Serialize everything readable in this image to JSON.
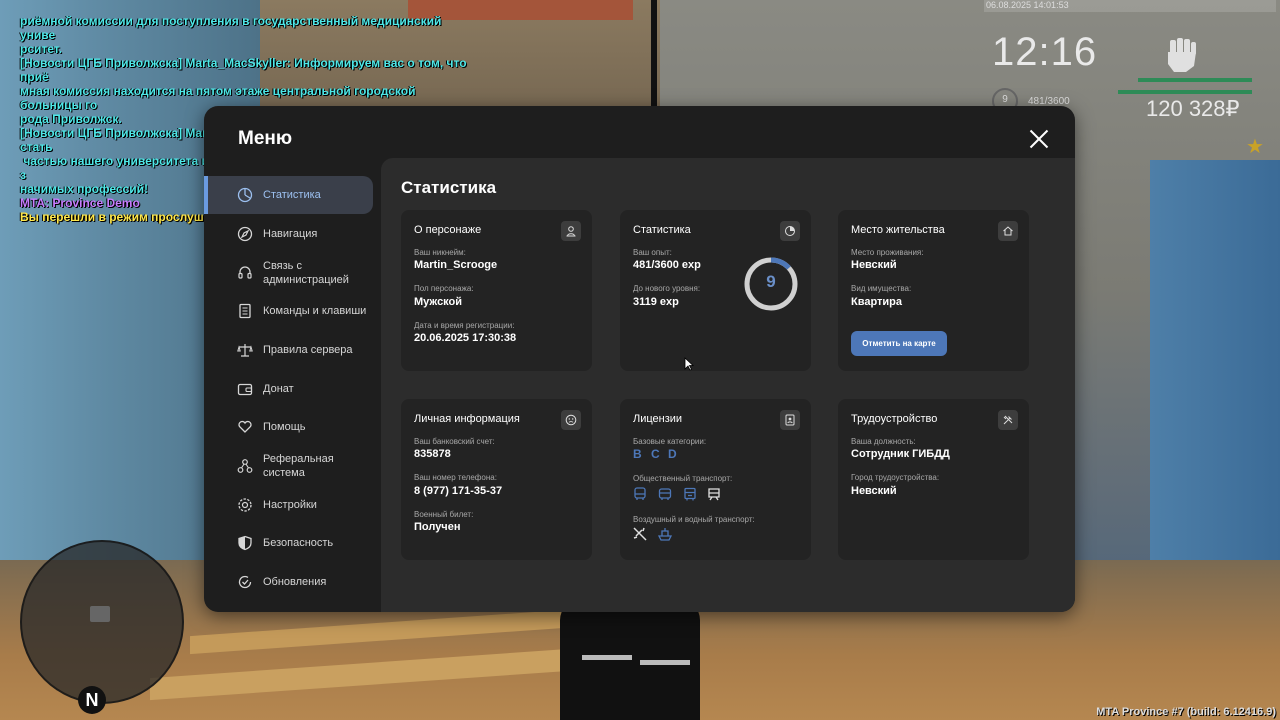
{
  "chat": [
    {
      "text": "риёмной комиссии для поступления в государственный медицинский униве\nрситет.",
      "color": "cyan"
    },
    {
      "text": "[Новости ЦГБ Приволжска] Marta_MacSkyller: Информируем вас о том, что приё\nмная комиссия находится на пятом этаже центральной городской больницы го\nрода Приволжск.",
      "color": "cyan"
    },
    {
      "text": "[Новости ЦГБ Приволжска] Marta_MacSkyller: Не упустите возможность стать\n частью нашего университета и освоить одну из самых востребованных и з\nначимых профессий!",
      "color": "cyan"
    },
    {
      "text": "MTA: Province Demo",
      "color": "purple"
    },
    {
      "text": "Вы перешли в режим прослушивания рации.",
      "color": "yellow"
    }
  ],
  "hud": {
    "datetime": "06.08.2025 14:01:53",
    "time": "12:16",
    "level": "9",
    "xp": "481/3600",
    "money": "120 328₽"
  },
  "build": "MTA Province #7 (build: 6.12416.9)",
  "radar": {
    "north": "N"
  },
  "menu": {
    "title": "Меню",
    "sidebar": [
      {
        "label": "Статистика",
        "icon": "pie-chart-icon",
        "active": true
      },
      {
        "label": "Навигация",
        "icon": "compass-icon"
      },
      {
        "label": "Связь с\nадминистрацией",
        "icon": "headset-icon"
      },
      {
        "label": "Команды и клавиши",
        "icon": "document-icon"
      },
      {
        "label": "Правила сервера",
        "icon": "scales-icon"
      },
      {
        "label": "Донат",
        "icon": "wallet-icon"
      },
      {
        "label": "Помощь",
        "icon": "heart-hands-icon"
      },
      {
        "label": "Реферальная\nсистема",
        "icon": "network-icon"
      },
      {
        "label": "Настройки",
        "icon": "gear-icon"
      },
      {
        "label": "Безопасность",
        "icon": "shield-icon"
      },
      {
        "label": "Обновления",
        "icon": "refresh-check-icon"
      }
    ],
    "content_title": "Статистика",
    "cards": {
      "character": {
        "title": "О персонаже",
        "nickname_label": "Ваш никнейм:",
        "nickname": "Martin_Scrooge",
        "gender_label": "Пол персонажа:",
        "gender": "Мужской",
        "reg_label": "Дата и время регистрации:",
        "reg": "20.06.2025 17:30:38"
      },
      "stats": {
        "title": "Статистика",
        "exp_label": "Ваш опыт:",
        "exp": "481/3600 exp",
        "next_label": "До нового уровня:",
        "next": "3119 exp",
        "level": "9",
        "level_progress": 0.1336
      },
      "residence": {
        "title": "Место жительства",
        "place_label": "Место проживания:",
        "place": "Невский",
        "property_label": "Вид имущества:",
        "property": "Квартира",
        "button": "Отметить на карте"
      },
      "personal": {
        "title": "Личная информация",
        "bank_label": "Ваш банковский счет:",
        "bank": "835878",
        "phone_label": "Ваш номер телефона:",
        "phone": "8 (977) 171-35-37",
        "military_label": "Военный билет:",
        "military": "Получен"
      },
      "licenses": {
        "title": "Лицензии",
        "base_label": "Базовые категории:",
        "base": [
          "B",
          "C",
          "D"
        ],
        "public_label": "Общественный транспорт:",
        "public_icons": [
          "bus-icon",
          "trolleybus-icon",
          "tram-icon",
          "metro-icon"
        ],
        "airwater_label": "Воздушный и водный транспорт:",
        "airwater_icons": [
          "plane-icon",
          "boat-icon"
        ]
      },
      "employment": {
        "title": "Трудоустройство",
        "position_label": "Ваша должность:",
        "position": "Сотрудник ГИБДД",
        "city_label": "Город трудоустройства:",
        "city": "Невский"
      }
    }
  },
  "colors": {
    "accent": "#4d77b8",
    "panel": "#1e1e1e",
    "card": "#232323",
    "money_bar": "#2e8b57"
  }
}
